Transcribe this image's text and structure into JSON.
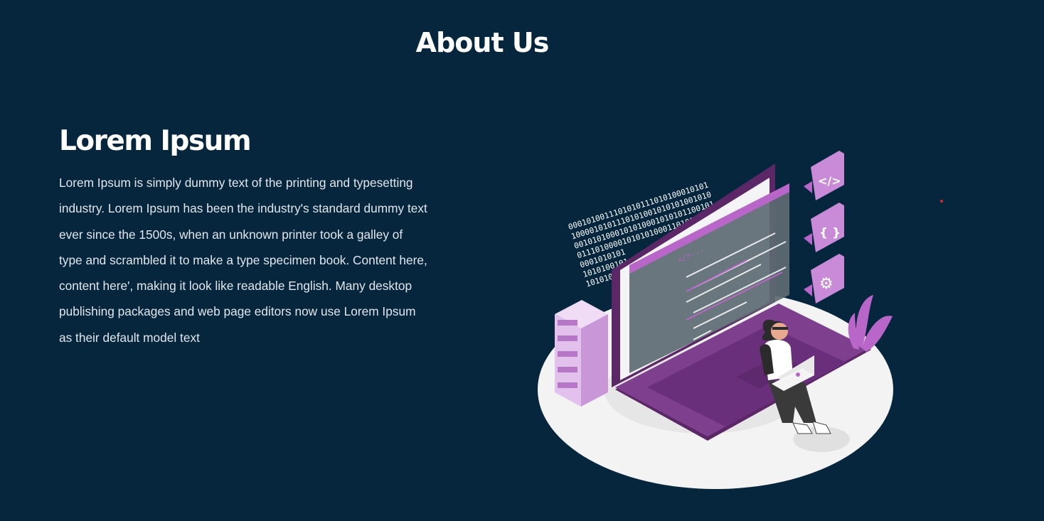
{
  "section": {
    "title": "About Us"
  },
  "about": {
    "heading": "Lorem Ipsum",
    "body": "Lorem Ipsum is simply dummy text of the printing and typesetting industry. Lorem Ipsum has been the industry's standard dummy text ever since the 1500s, when an unknown printer took a galley of type and scrambled it to make a type specimen book. Content here, content here', making it look like readable English. Many desktop publishing packages and web page editors now use Lorem Ipsum as their default model text"
  },
  "illustration": {
    "binary_lines": [
      "0001010011101010111010100010101",
      "1000010101110101001010101001010",
      "0010101000101010001010101100101",
      "0111010000101010100011010101001",
      "0001010101",
      "1010100101",
      "1010100011"
    ],
    "code_label": "</>...",
    "bubble_icons": [
      "code-icon",
      "braces-icon",
      "gear-icon"
    ],
    "bubble_glyphs": [
      "</>",
      "{ }",
      "⚙"
    ],
    "colors": {
      "background": "#05263d",
      "accent": "#b866c8",
      "laptop": "#7e3f8f",
      "laptop_dark": "#5b2766",
      "floor": "#f3f3f3",
      "screen": "#5d6a72"
    }
  },
  "indicator": {
    "color": "#e0262e"
  }
}
